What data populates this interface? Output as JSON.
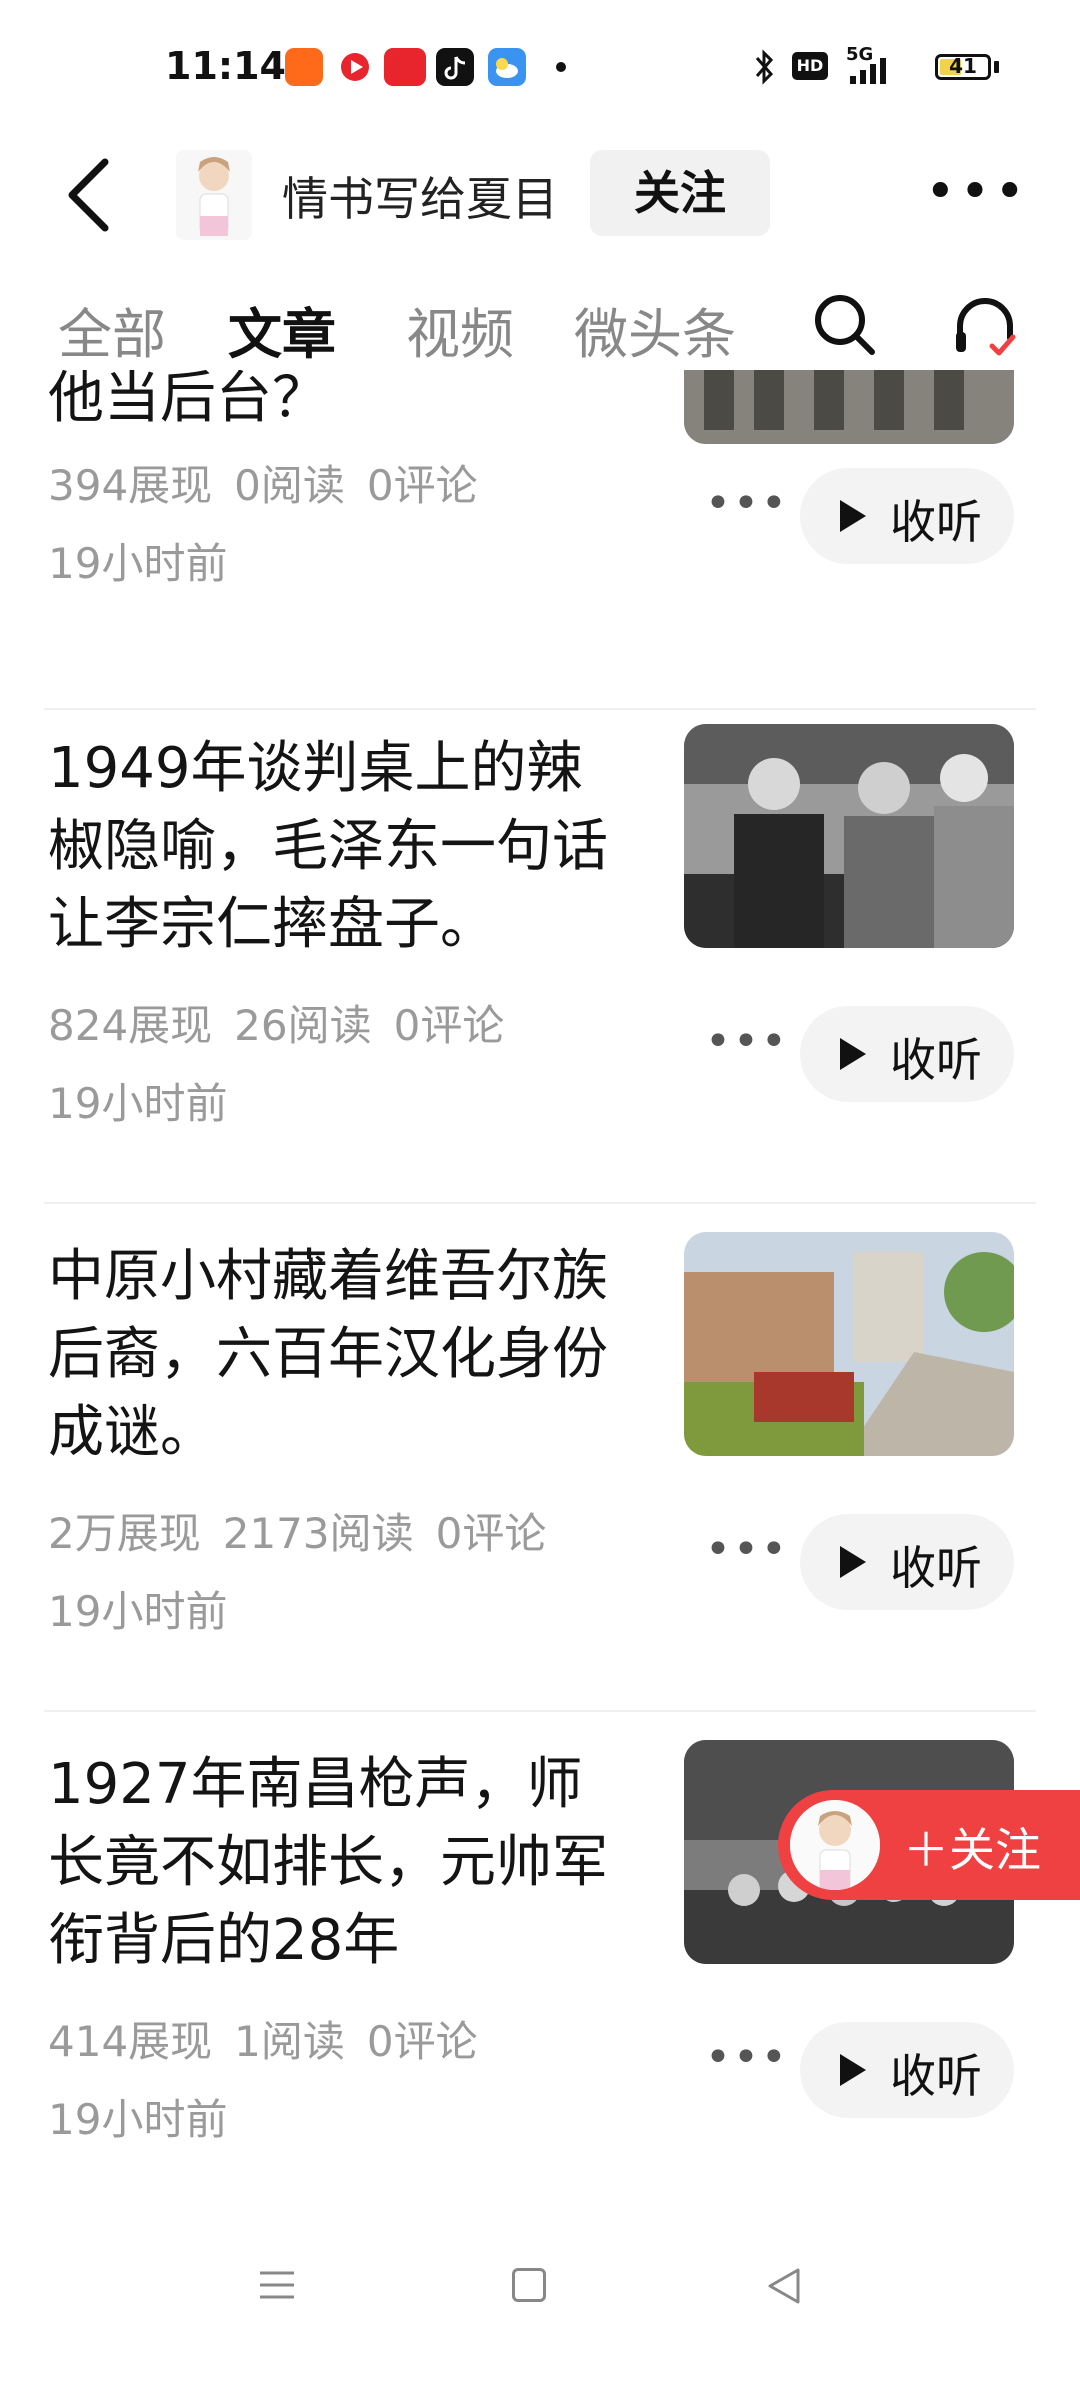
{
  "status_bar": {
    "time": "11:14",
    "icons": [
      "kuaishou-icon",
      "video-app-icon",
      "toutiao-icon",
      "tiktok-icon",
      "weather-icon"
    ],
    "network": "5G",
    "hd": "HD",
    "battery": "41"
  },
  "header": {
    "author_name": "情书写给夏目",
    "follow_label": "关注"
  },
  "tabs": [
    {
      "label": "全部",
      "active": false
    },
    {
      "label": "文章",
      "active": true
    },
    {
      "label": "视频",
      "active": false
    },
    {
      "label": "微头条",
      "active": false
    }
  ],
  "articles": [
    {
      "title": "他当后台？",
      "views": "394展现",
      "reads": "0阅读",
      "comments": "0评论",
      "time": "19小时前",
      "listen_label": "收听"
    },
    {
      "title": "1949年谈判桌上的辣椒隐喻，毛泽东一句话让李宗仁摔盘子。",
      "views": "824展现",
      "reads": "26阅读",
      "comments": "0评论",
      "time": "19小时前",
      "listen_label": "收听"
    },
    {
      "title": "中原小村藏着维吾尔族后裔，六百年汉化身份成谜。",
      "views": "2万展现",
      "reads": "2173阅读",
      "comments": "0评论",
      "time": "19小时前",
      "listen_label": "收听"
    },
    {
      "title": "1927年南昌枪声，师长竟不如排长，元帅军衔背后的28年",
      "views": "414展现",
      "reads": "1阅读",
      "comments": "0评论",
      "time": "19小时前",
      "listen_label": "收听"
    }
  ],
  "floating_follow": {
    "label": "＋关注"
  },
  "colors": {
    "accent_red": "#f04142",
    "meta_gray": "#9a9a9a",
    "tab_inactive": "#888888"
  }
}
